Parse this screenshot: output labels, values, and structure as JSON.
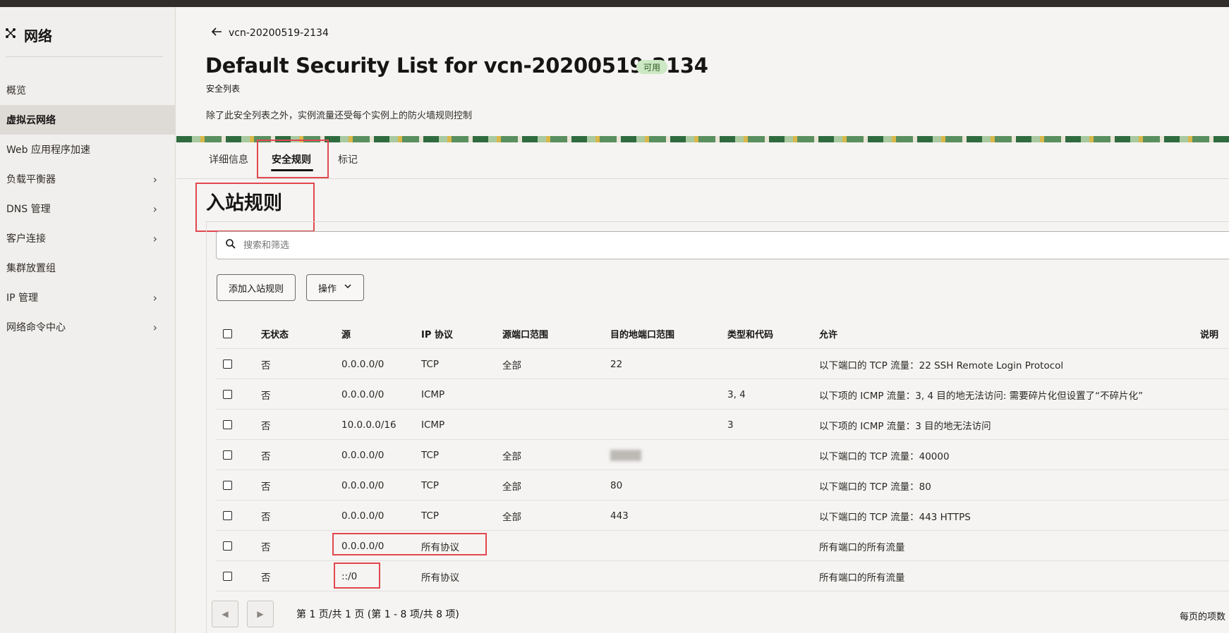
{
  "sidebar": {
    "title": "网络",
    "items": [
      {
        "label": "概览",
        "chevron": false
      },
      {
        "label": "虚拟云网络",
        "chevron": false,
        "active": true
      },
      {
        "label": "Web 应用程序加速",
        "chevron": false
      },
      {
        "label": "负载平衡器",
        "chevron": true
      },
      {
        "label": "DNS 管理",
        "chevron": true
      },
      {
        "label": "客户连接",
        "chevron": true
      },
      {
        "label": "集群放置组",
        "chevron": false
      },
      {
        "label": "IP 管理",
        "chevron": true
      },
      {
        "label": "网络命令中心",
        "chevron": true
      }
    ]
  },
  "header": {
    "back_link": "vcn-20200519-2134",
    "title": "Default Security List for vcn-20200519-2134",
    "status_badge": "可用",
    "subtitle": "安全列表",
    "description": "除了此安全列表之外，实例流量还受每个实例上的防火墙规则控制"
  },
  "tabs": [
    "详细信息",
    "安全规则",
    "标记"
  ],
  "active_tab": "安全规则",
  "section_title": "入站规则",
  "search": {
    "placeholder": "搜索和筛选"
  },
  "buttons": {
    "add_rule": "添加入站规则",
    "actions": "操作"
  },
  "table": {
    "headers": [
      "无状态",
      "源",
      "IP 协议",
      "源端口范围",
      "目的地端口范围",
      "类型和代码",
      "允许",
      "说明"
    ],
    "rows": [
      [
        "否",
        "0.0.0.0/0",
        "TCP",
        "全部",
        "22",
        "",
        "以下端口的 TCP 流量：22 SSH Remote Login Protocol"
      ],
      [
        "否",
        "0.0.0.0/0",
        "ICMP",
        "",
        "",
        "3, 4",
        "以下项的 ICMP 流量：3, 4 目的地无法访问: 需要碎片化但设置了“不碎片化”"
      ],
      [
        "否",
        "10.0.0.0/16",
        "ICMP",
        "",
        "",
        "3",
        "以下项的 ICMP 流量：3 目的地无法访问"
      ],
      [
        "否",
        "0.0.0.0/0",
        "TCP",
        "全部",
        "",
        "",
        "以下端口的 TCP 流量：40000"
      ],
      [
        "否",
        "0.0.0.0/0",
        "TCP",
        "全部",
        "80",
        "",
        "以下端口的 TCP 流量：80"
      ],
      [
        "否",
        "0.0.0.0/0",
        "TCP",
        "全部",
        "443",
        "",
        "以下端口的 TCP 流量：443 HTTPS"
      ],
      [
        "否",
        "0.0.0.0/0",
        "所有协议",
        "",
        "",
        "",
        "所有端口的所有流量"
      ],
      [
        "否",
        "::/0",
        "所有协议",
        "",
        "",
        "",
        "所有端口的所有流量"
      ]
    ]
  },
  "pagination": {
    "info": "第 1 页/共 1 页 (第 1 - 8 项/共 8 项)",
    "per_page_label": "每页的项数"
  },
  "colors": {
    "highlight": "#e2474f",
    "badge_bg": "#cde8c5",
    "active_nav": "#dedbd7"
  }
}
